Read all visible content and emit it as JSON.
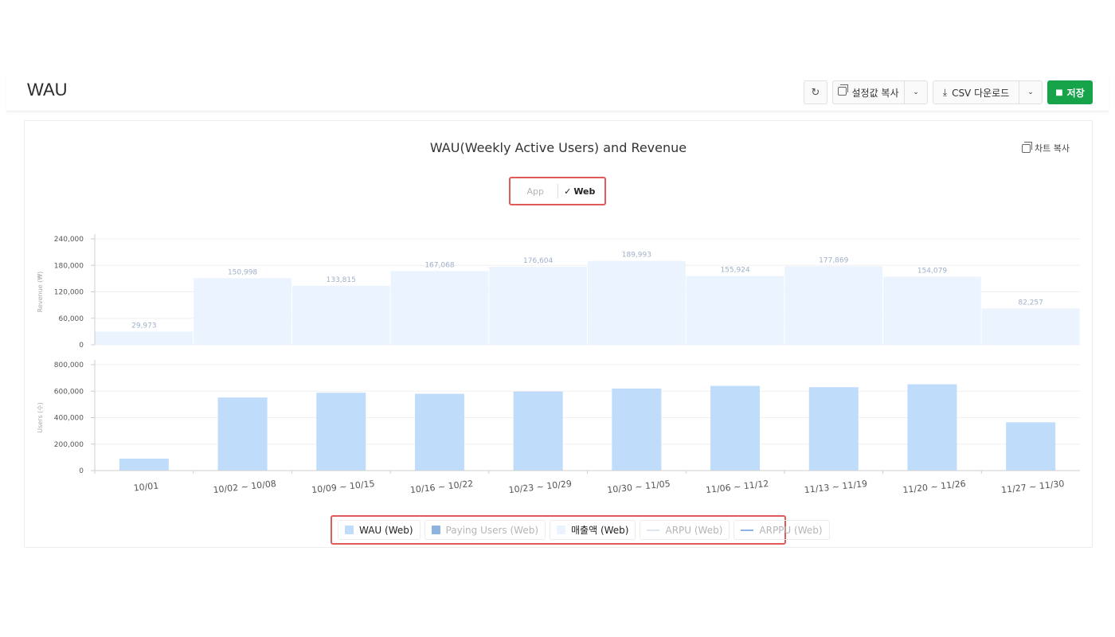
{
  "header": {
    "title": "WAU",
    "refresh_icon": "refresh-icon",
    "copy_settings_label": "설정값 복사",
    "csv_download_label": "CSV 다운로드",
    "save_label": "저장"
  },
  "chart_card": {
    "copy_label": "차트 복사",
    "platform_toggle": {
      "options": [
        "App",
        "Web"
      ],
      "selected": "Web",
      "check": "✓"
    }
  },
  "colors": {
    "wau": "#bfdcfb",
    "revenue": "#eaf3fe",
    "paying_users": "#8fb3e0",
    "arpu": "#dbe7f5",
    "arppu": "#8fb3e0",
    "save_button": "#16a34a",
    "highlight_border": "#e05a5a"
  },
  "chart_data": {
    "title": "WAU(Weekly Active Users) and Revenue",
    "categories": [
      "10/01",
      "10/02 ~ 10/08",
      "10/09 ~ 10/15",
      "10/16 ~ 10/22",
      "10/23 ~ 10/29",
      "10/30 ~ 11/05",
      "11/06 ~ 11/12",
      "11/13 ~ 11/19",
      "11/20 ~ 11/26",
      "11/27 ~ 11/30"
    ],
    "panels": [
      {
        "type": "bar",
        "ylabel": "Revenue (₩)",
        "ylim": [
          0,
          240000
        ],
        "yticks": [
          "240,000",
          "180,000",
          "120,000",
          "60,000",
          "0"
        ],
        "series": [
          {
            "name": "매출액 (Web)",
            "values": [
              29973,
              150998,
              133815,
              167068,
              176604,
              189993,
              155924,
              177869,
              154079,
              82257
            ],
            "labels": [
              "29,973",
              "150,998",
              "133,815",
              "167,068",
              "176,604",
              "189,993",
              "155,924",
              "177,869",
              "154,079",
              "82,257"
            ]
          }
        ]
      },
      {
        "type": "bar",
        "ylabel": "Users (수)",
        "ylim": [
          0,
          800000
        ],
        "yticks": [
          "800,000",
          "600,000",
          "400,000",
          "200,000",
          "0"
        ],
        "series": [
          {
            "name": "WAU (Web)",
            "values": [
              90000,
              552000,
              588000,
              580000,
              597000,
              620000,
              640000,
              630000,
              652000,
              365000
            ]
          }
        ]
      }
    ],
    "legend": [
      {
        "name": "WAU (Web)",
        "active": true,
        "marker": "square",
        "color": "#bfdcfb"
      },
      {
        "name": "Paying Users (Web)",
        "active": false,
        "marker": "square",
        "color": "#8fb3e0"
      },
      {
        "name": "매출액 (Web)",
        "active": true,
        "marker": "square",
        "color": "#eaf3fe"
      },
      {
        "name": "ARPU (Web)",
        "active": false,
        "marker": "line",
        "color": "#dbe7f5"
      },
      {
        "name": "ARPPU (Web)",
        "active": false,
        "marker": "line",
        "color": "#8fb3e0"
      }
    ],
    "legend_position": "bottom",
    "grid": true
  }
}
